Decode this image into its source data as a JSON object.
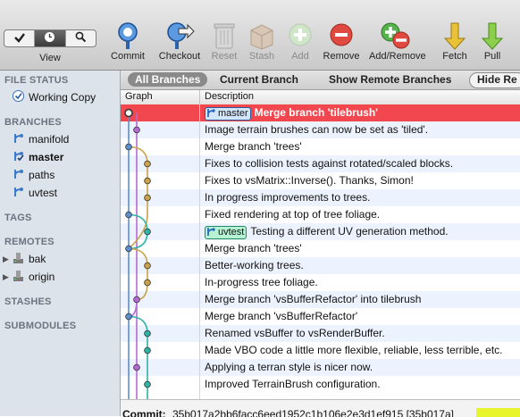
{
  "toolbar": {
    "view_label": "View",
    "buttons": {
      "commit": "Commit",
      "checkout": "Checkout",
      "reset": "Reset",
      "stash": "Stash",
      "add": "Add",
      "remove": "Remove",
      "add_remove": "Add/Remove",
      "fetch": "Fetch",
      "pull": "Pull"
    }
  },
  "sidebar": {
    "file_status": {
      "title": "FILE STATUS",
      "working_copy": "Working Copy"
    },
    "branches": {
      "title": "BRANCHES",
      "items": [
        "manifold",
        "master",
        "paths",
        "uvtest"
      ],
      "current": "master"
    },
    "tags": {
      "title": "TAGS"
    },
    "remotes": {
      "title": "REMOTES",
      "items": [
        "bak",
        "origin"
      ]
    },
    "stashes": {
      "title": "STASHES"
    },
    "submodules": {
      "title": "SUBMODULES"
    }
  },
  "filter": {
    "all_branches": "All Branches",
    "current_branch": "Current Branch",
    "show_remote": "Show Remote Branches",
    "hide_remote": "Hide Re"
  },
  "columns": {
    "graph": "Graph",
    "description": "Description"
  },
  "commits": [
    {
      "tag": "master",
      "text": "Merge branch 'tilebrush'"
    },
    {
      "text": "Image terrain brushes can now be set as 'tiled'."
    },
    {
      "text": "Merge branch 'trees'"
    },
    {
      "text": "Fixes to collision tests against rotated/scaled blocks."
    },
    {
      "text": "Fixes to vsMatrix::Inverse().  Thanks, Simon!"
    },
    {
      "text": "In progress improvements to trees."
    },
    {
      "text": "Fixed rendering at top of tree foliage."
    },
    {
      "tag": "uvtest",
      "text": "Testing a different UV generation method."
    },
    {
      "text": "Merge branch 'trees'"
    },
    {
      "text": "Better-working trees."
    },
    {
      "text": "In-progress tree foliage."
    },
    {
      "text": "Merge branch 'vsBufferRefactor' into tilebrush"
    },
    {
      "text": "Merge branch 'vsBufferRefactor'"
    },
    {
      "text": "Renamed vsBuffer to vsRenderBuffer."
    },
    {
      "text": "Made VBO code a little more flexible, reliable, less terrible, etc."
    },
    {
      "text": "Applying a terran style is nicer now."
    },
    {
      "text": "Improved TerrainBrush configuration."
    }
  ],
  "commit_info": {
    "label": "Commit:",
    "value": "35b017a2bb6facc6eed1952c1b106e2e3d1ef915 [35b017a]"
  },
  "colors": {
    "selected_row": "#f2474f",
    "alt_row": "#edf3fe",
    "sidebar": "#dde3ea",
    "lane_blue": "#5b8fd0",
    "lane_teal": "#2fb3a6",
    "lane_olive": "#c9a24a",
    "lane_purple": "#b56ad3"
  }
}
